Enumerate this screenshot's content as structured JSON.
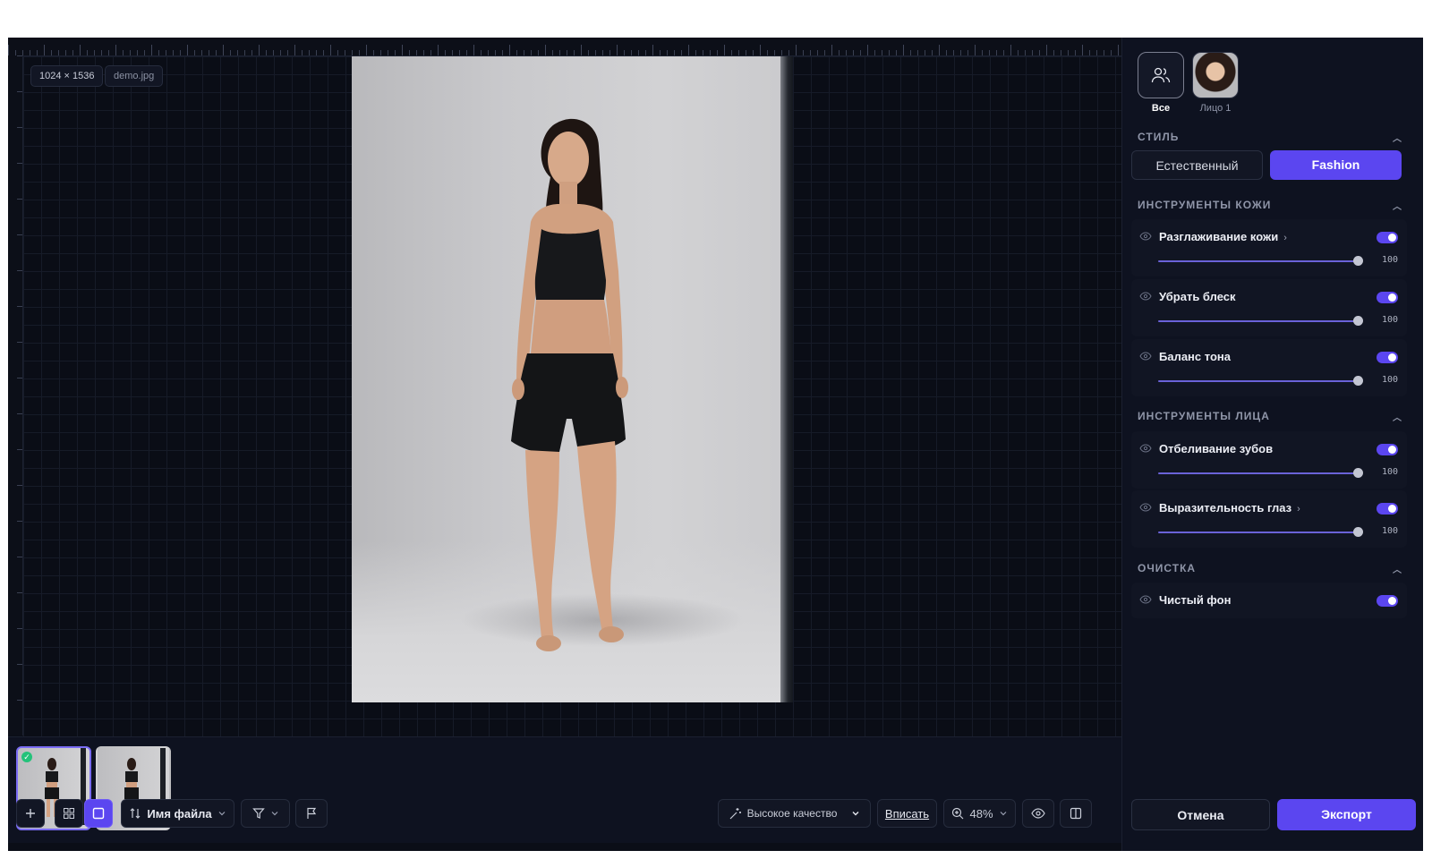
{
  "canvas": {
    "dimensions_chip": "1024 × 1536",
    "filename_chip": "demo.jpg"
  },
  "filmstrip": {
    "thumbs": [
      {
        "number": "1",
        "selected": true,
        "done": true
      },
      {
        "number": "2",
        "selected": false,
        "done": false
      }
    ]
  },
  "bottombar": {
    "add_icon": "plus-icon",
    "grid_icon": "grid-icon",
    "single_icon": "square-icon",
    "sort_label": "Имя файла",
    "filter_icon": "filter-icon",
    "flag_icon": "flag-icon",
    "quality_label": "Высокое качество",
    "fit_label": "Вписать",
    "zoom_label": "48%",
    "preview_icon": "eye-icon",
    "compare_icon": "split-view-icon"
  },
  "panel": {
    "faces": [
      {
        "label": "Все",
        "icon": "users-icon",
        "selected": true
      },
      {
        "label": "Лицо 1",
        "icon": "face-thumbnail",
        "selected": false
      }
    ],
    "style": {
      "title": "СТИЛЬ",
      "options": [
        "Естественный",
        "Fashion"
      ],
      "selected": "Fashion"
    },
    "skin": {
      "title": "ИНСТРУМЕНТЫ КОЖИ",
      "tools": [
        {
          "name": "Разглаживание кожи",
          "has_more": true,
          "enabled": true,
          "value": "100"
        },
        {
          "name": "Убрать блеск",
          "has_more": false,
          "enabled": true,
          "value": "100"
        },
        {
          "name": "Баланс тона",
          "has_more": false,
          "enabled": true,
          "value": "100"
        }
      ]
    },
    "face": {
      "title": "ИНСТРУМЕНТЫ ЛИЦА",
      "tools": [
        {
          "name": "Отбеливание зубов",
          "has_more": false,
          "enabled": true,
          "value": "100"
        },
        {
          "name": "Выразительность глаз",
          "has_more": true,
          "enabled": true,
          "value": "100"
        }
      ]
    },
    "cleanup": {
      "title": "ОЧИСТКА",
      "tools": [
        {
          "name": "Чистый фон",
          "enabled": true
        }
      ]
    },
    "cancel_label": "Отмена",
    "export_label": "Экспорт"
  },
  "colors": {
    "accent": "#5b46f0",
    "background": "#0b0e17",
    "panel": "#0e1220",
    "success": "#24c27a"
  }
}
